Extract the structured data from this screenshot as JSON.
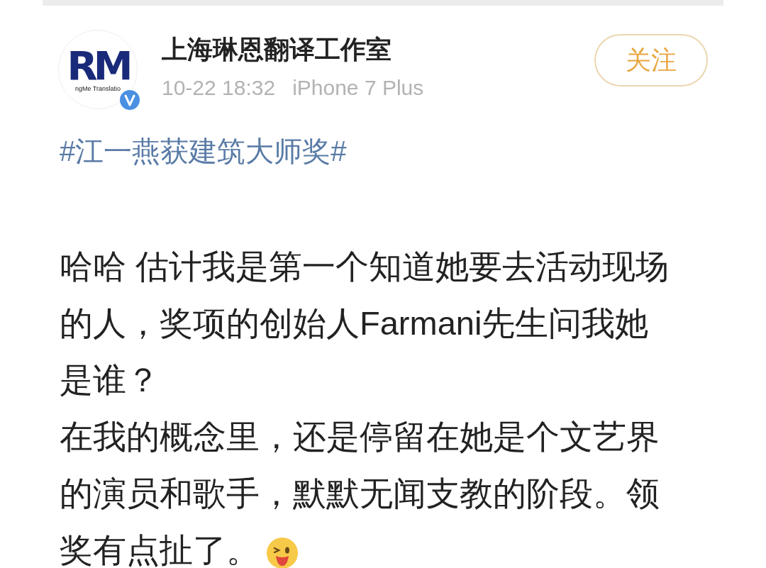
{
  "post": {
    "avatar": {
      "logo": "RM",
      "caption": "ngMe Translatio",
      "verified": true
    },
    "author": "上海琳恩翻译工作室",
    "time": "10-22 18:32",
    "source": "iPhone 7 Plus",
    "follow_button": "关注",
    "hashtag": "#江一燕获建筑大师奖#",
    "paragraphs": [
      {
        "text": "哈哈 估计我是第一个知道她要去活动现场的人，奖项的创始人Farmani先生问我她是谁？",
        "emoji": false
      },
      {
        "text": "在我的概念里，还是停留在她是个文艺界的演员和歌手，默默无闻支教的阶段。领奖有点扯了。",
        "emoji": true
      }
    ]
  }
}
